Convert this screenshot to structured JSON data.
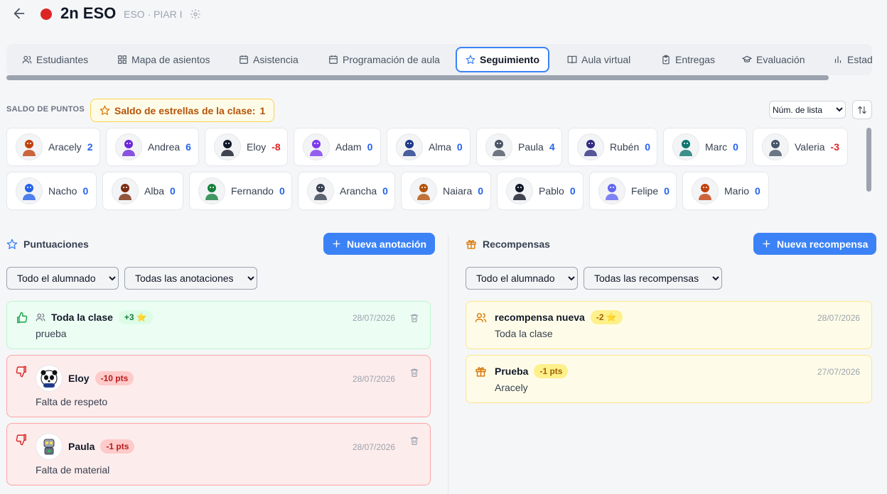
{
  "header": {
    "title": "2n ESO",
    "subtitle": "ESO · PIAR I",
    "class_color": "#dc2626"
  },
  "tabs": [
    {
      "label": "Estudiantes",
      "icon": "users-icon"
    },
    {
      "label": "Mapa de asientos",
      "icon": "grid-icon"
    },
    {
      "label": "Asistencia",
      "icon": "calendar-icon"
    },
    {
      "label": "Programación de aula",
      "icon": "calendar-icon"
    },
    {
      "label": "Seguimiento",
      "icon": "star-icon",
      "active": true
    },
    {
      "label": "Aula virtual",
      "icon": "book-icon"
    },
    {
      "label": "Entregas",
      "icon": "clipboard-icon"
    },
    {
      "label": "Evaluación",
      "icon": "graduation-cap-icon"
    },
    {
      "label": "Estad",
      "icon": "bar-chart-icon"
    }
  ],
  "saldo": {
    "label": "SALDO DE PUNTOS",
    "badge_label": "Saldo de estrellas de la clase:",
    "badge_value": "1"
  },
  "sort": {
    "selected": "Núm. de lista"
  },
  "students": [
    {
      "name": "Aracely",
      "points": "2"
    },
    {
      "name": "Andrea",
      "points": "6"
    },
    {
      "name": "Eloy",
      "points": "-8"
    },
    {
      "name": "Adam",
      "points": "0"
    },
    {
      "name": "Alma",
      "points": "0"
    },
    {
      "name": "Paula",
      "points": "4"
    },
    {
      "name": "Rubén",
      "points": "0"
    },
    {
      "name": "Marc",
      "points": "0"
    },
    {
      "name": "Valeria",
      "points": "-3"
    },
    {
      "name": "Nacho",
      "points": "0"
    },
    {
      "name": "Alba",
      "points": "0"
    },
    {
      "name": "Fernando",
      "points": "0"
    },
    {
      "name": "Arancha",
      "points": "0"
    },
    {
      "name": "Naiara",
      "points": "0"
    },
    {
      "name": "Pablo",
      "points": "0"
    },
    {
      "name": "Felipe",
      "points": "0"
    },
    {
      "name": "Mario",
      "points": "0"
    }
  ],
  "puntuaciones": {
    "title": "Puntuaciones",
    "new_button": "Nueva anotación",
    "filter_students": "Todo el alumnado",
    "filter_type": "Todas las anotaciones",
    "entries": [
      {
        "who": "Toda la clase",
        "pill": "+3 ⭐",
        "date": "28/07/2026",
        "desc": "prueba"
      },
      {
        "who": "Eloy",
        "pill": "-10 pts",
        "date": "28/07/2026",
        "desc": "Falta de respeto"
      },
      {
        "who": "Paula",
        "pill": "-1 pts",
        "date": "28/07/2026",
        "desc": "Falta de material"
      }
    ]
  },
  "recompensas": {
    "title": "Recompensas",
    "new_button": "Nueva recompensa",
    "filter_students": "Todo el alumnado",
    "filter_type": "Todas las recompensas",
    "entries": [
      {
        "who": "recompensa nueva",
        "pill": "-2 ⭐",
        "date": "28/07/2026",
        "desc": "Toda la clase"
      },
      {
        "who": "Prueba",
        "pill": "-1 pts",
        "date": "27/07/2026",
        "desc": "Aracely"
      }
    ]
  }
}
